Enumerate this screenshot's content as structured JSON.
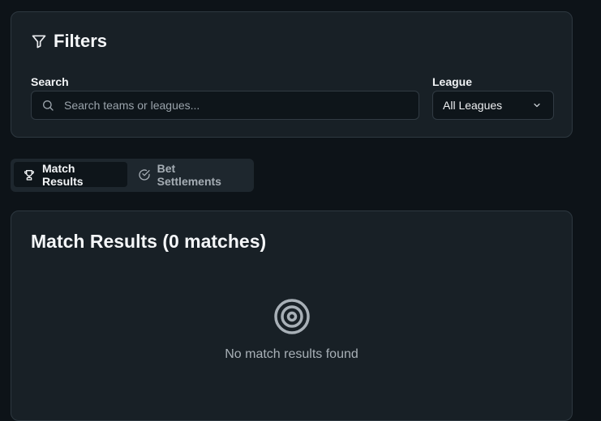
{
  "filters": {
    "title": "Filters",
    "icon": "filter-icon",
    "search": {
      "label": "Search",
      "placeholder": "Search teams or leagues...",
      "value": "",
      "icon": "search-icon"
    },
    "league": {
      "label": "League",
      "selected": "All Leagues",
      "icon": "chevron-down-icon"
    }
  },
  "tabs": [
    {
      "label": "Match Results",
      "icon": "trophy-icon",
      "active": true
    },
    {
      "label": "Bet Settlements",
      "icon": "check-circle-icon",
      "active": false
    }
  ],
  "results": {
    "title": "Match Results (0 matches)",
    "empty_icon": "target-icon",
    "empty_message": "No match results found"
  },
  "colors": {
    "background": "#0d1318",
    "card": "#182026",
    "border": "#2e3840",
    "input_bg": "#0e151a",
    "text_primary": "#f4f6f8",
    "text_muted": "#a8b0b7"
  }
}
